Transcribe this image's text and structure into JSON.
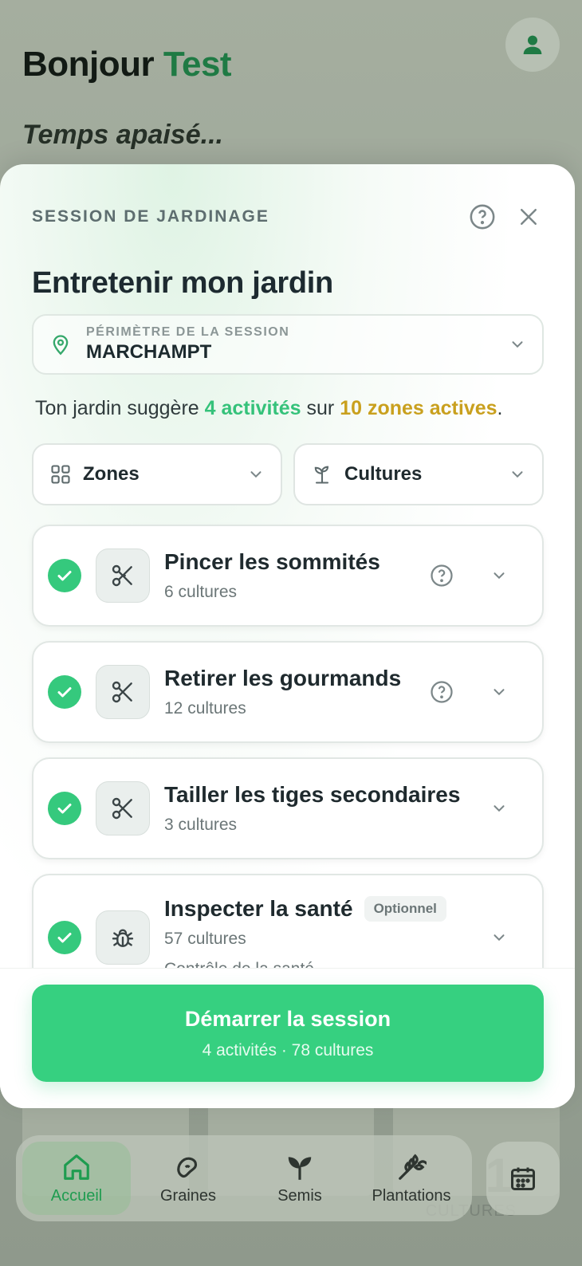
{
  "background": {
    "greeting_prefix": "Bonjour",
    "greeting_name": "Test",
    "weather": "Temps apaisé...",
    "stat_number": "1",
    "stat_label": "CULTURES"
  },
  "bottom_nav": {
    "items": [
      {
        "label": "Accueil",
        "icon": "home-icon",
        "active": true
      },
      {
        "label": "Graines",
        "icon": "seed-icon",
        "active": false
      },
      {
        "label": "Semis",
        "icon": "sprout-icon",
        "active": false
      },
      {
        "label": "Plantations",
        "icon": "wheat-icon",
        "active": false
      }
    ],
    "calendar_icon": "calendar-icon"
  },
  "sheet": {
    "eyebrow": "SESSION DE JARDINAGE",
    "title": "Entretenir mon jardin",
    "scope": {
      "label": "PÉRIMÈTRE DE LA SESSION",
      "value": "MARCHAMPT"
    },
    "suggestion": {
      "prefix": "Ton jardin suggère ",
      "activities": "4 activités",
      "middle": " sur ",
      "zones": "10 zones actives",
      "suffix": "."
    },
    "filters": {
      "zones": "Zones",
      "cultures": "Cultures"
    },
    "activities": [
      {
        "title": "Pincer les sommités",
        "sub": "6 cultures",
        "icon": "scissors-icon",
        "help": true
      },
      {
        "title": "Retirer les gourmands",
        "sub": "12 cultures",
        "icon": "scissors-icon",
        "help": true
      },
      {
        "title": "Tailler les tiges secondaires",
        "sub": "3 cultures",
        "icon": "scissors-icon",
        "help": false
      },
      {
        "title": "Inspecter la santé",
        "sub": "57 cultures",
        "icon": "bug-icon",
        "badge": "Optionnel",
        "extra": "Contrôle de la santé"
      }
    ],
    "cta": {
      "title": "Démarrer la session",
      "sub": "4 activités · 78 cultures"
    }
  },
  "colors": {
    "accent_green": "#36d080",
    "highlight_green": "#35c27a",
    "highlight_yellow": "#c9a01e"
  }
}
